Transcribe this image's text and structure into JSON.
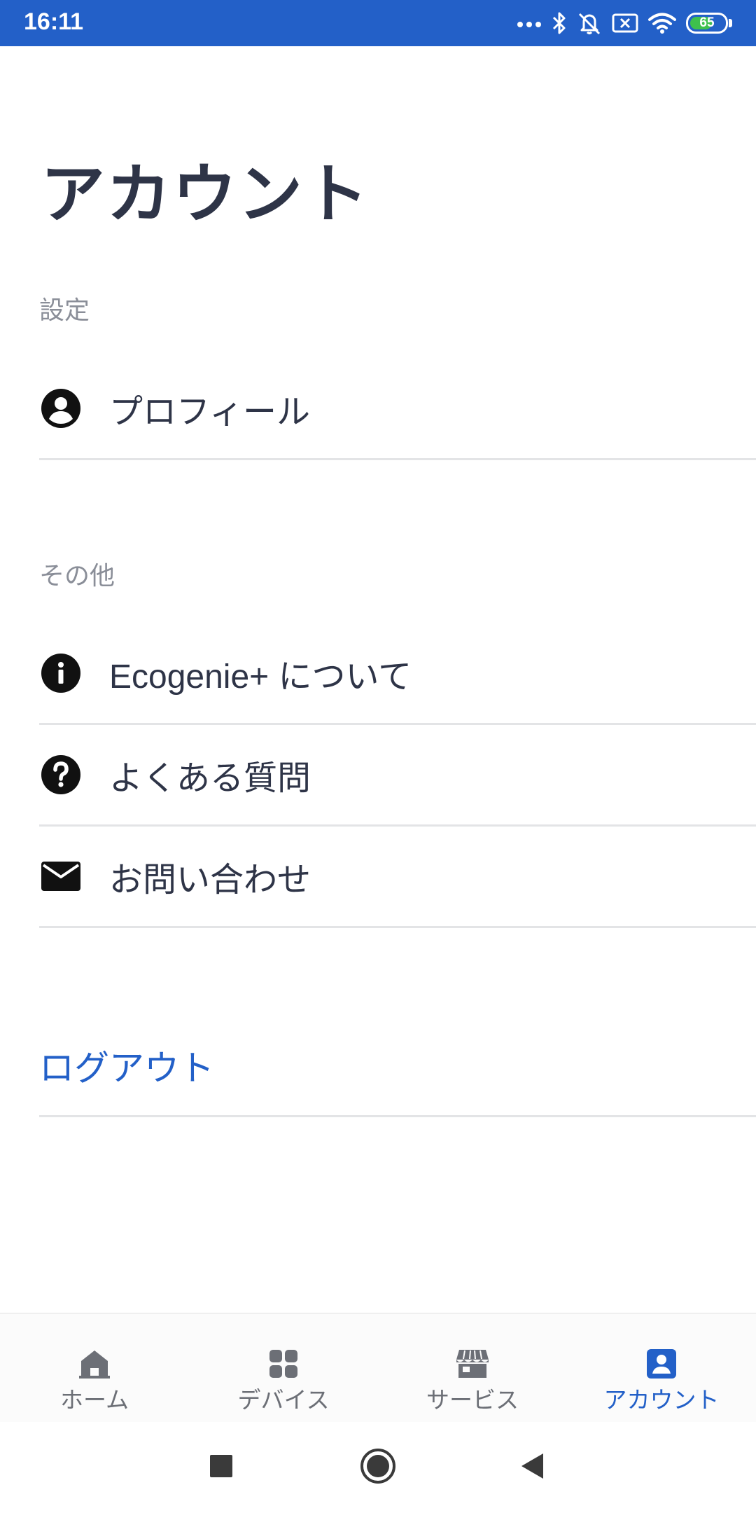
{
  "status_bar": {
    "time": "16:11",
    "battery_level": "65",
    "battery_fraction": 0.65,
    "icons": [
      "more-dots-icon",
      "bluetooth-icon",
      "notifications-off-icon",
      "sim-off-icon",
      "wifi-icon",
      "battery-icon"
    ],
    "background_color": "#2360c8",
    "battery_color": "#3ec14d"
  },
  "page": {
    "title": "アカウント"
  },
  "sections": {
    "settings": {
      "label": "設定",
      "items": [
        {
          "label": "プロフィール",
          "icon": "account-circle-icon"
        }
      ]
    },
    "other": {
      "label": "その他",
      "items": [
        {
          "label": "Ecogenie+ について",
          "icon": "info-icon"
        },
        {
          "label": "よくある質問",
          "icon": "help-icon"
        },
        {
          "label": "お問い合わせ",
          "icon": "mail-icon"
        }
      ]
    }
  },
  "logout": {
    "label": "ログアウト"
  },
  "bottom_nav": {
    "items": [
      {
        "label": "ホーム",
        "icon": "home-icon",
        "active": false
      },
      {
        "label": "デバイス",
        "icon": "devices-grid-icon",
        "active": false
      },
      {
        "label": "サービス",
        "icon": "store-icon",
        "active": false
      },
      {
        "label": "アカウント",
        "icon": "account-box-icon",
        "active": true
      }
    ],
    "active_color": "#2360c8",
    "inactive_color": "#6c6f76"
  },
  "system_nav": {
    "buttons": [
      "recents-button",
      "home-button",
      "back-button"
    ]
  },
  "colors": {
    "text_primary": "#2e3447",
    "text_secondary": "#8a8e98",
    "divider": "#e3e4e6",
    "accent": "#2360c8"
  }
}
